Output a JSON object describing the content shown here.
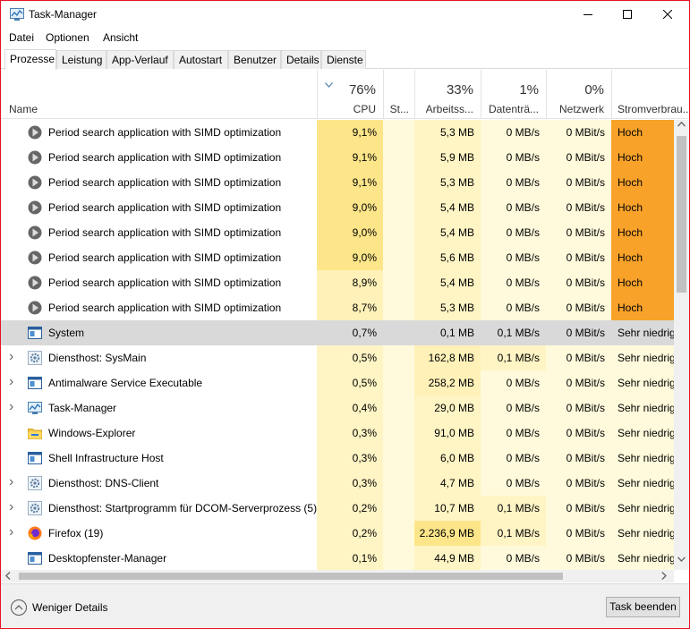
{
  "window": {
    "title": "Task-Manager"
  },
  "menu": [
    "Datei",
    "Optionen",
    "Ansicht"
  ],
  "tabs": [
    "Prozesse",
    "Leistung",
    "App-Verlauf",
    "Autostart",
    "Benutzer",
    "Details",
    "Dienste"
  ],
  "active_tab": "Prozesse",
  "columns": {
    "name": "Name",
    "cpu": {
      "pct": "76%",
      "label": "CPU"
    },
    "status": {
      "label": "St..."
    },
    "memory": {
      "pct": "33%",
      "label": "Arbeitss..."
    },
    "disk": {
      "pct": "1%",
      "label": "Datenträ..."
    },
    "network": {
      "pct": "0%",
      "label": "Netzwerk"
    },
    "power": {
      "label": "Stromverbrau..."
    }
  },
  "processes": [
    {
      "name": "Period search application with SIMD optimization",
      "icon": "play-app-icon",
      "expandable": false,
      "cpu": "9,1%",
      "memory": "5,3 MB",
      "disk": "0 MB/s",
      "network": "0 MBit/s",
      "power": "Hoch"
    },
    {
      "name": "Period search application with SIMD optimization",
      "icon": "play-app-icon",
      "expandable": false,
      "cpu": "9,1%",
      "memory": "5,9 MB",
      "disk": "0 MB/s",
      "network": "0 MBit/s",
      "power": "Hoch"
    },
    {
      "name": "Period search application with SIMD optimization",
      "icon": "play-app-icon",
      "expandable": false,
      "cpu": "9,1%",
      "memory": "5,3 MB",
      "disk": "0 MB/s",
      "network": "0 MBit/s",
      "power": "Hoch"
    },
    {
      "name": "Period search application with SIMD optimization",
      "icon": "play-app-icon",
      "expandable": false,
      "cpu": "9,0%",
      "memory": "5,4 MB",
      "disk": "0 MB/s",
      "network": "0 MBit/s",
      "power": "Hoch"
    },
    {
      "name": "Period search application with SIMD optimization",
      "icon": "play-app-icon",
      "expandable": false,
      "cpu": "9,0%",
      "memory": "5,4 MB",
      "disk": "0 MB/s",
      "network": "0 MBit/s",
      "power": "Hoch"
    },
    {
      "name": "Period search application with SIMD optimization",
      "icon": "play-app-icon",
      "expandable": false,
      "cpu": "9,0%",
      "memory": "5,6 MB",
      "disk": "0 MB/s",
      "network": "0 MBit/s",
      "power": "Hoch"
    },
    {
      "name": "Period search application with SIMD optimization",
      "icon": "play-app-icon",
      "expandable": false,
      "cpu": "8,9%",
      "memory": "5,4 MB",
      "disk": "0 MB/s",
      "network": "0 MBit/s",
      "power": "Hoch"
    },
    {
      "name": "Period search application with SIMD optimization",
      "icon": "play-app-icon",
      "expandable": false,
      "cpu": "8,7%",
      "memory": "5,3 MB",
      "disk": "0 MB/s",
      "network": "0 MBit/s",
      "power": "Hoch"
    },
    {
      "name": "System",
      "icon": "window-app-icon",
      "expandable": false,
      "selected": true,
      "cpu": "0,7%",
      "memory": "0,1 MB",
      "disk": "0,1 MB/s",
      "network": "0 MBit/s",
      "power": "Sehr niedrig"
    },
    {
      "name": "Diensthost: SysMain",
      "icon": "gear-icon",
      "expandable": true,
      "cpu": "0,5%",
      "memory": "162,8 MB",
      "disk": "0,1 MB/s",
      "network": "0 MBit/s",
      "power": "Sehr niedrig"
    },
    {
      "name": "Antimalware Service Executable",
      "icon": "window-app-icon",
      "expandable": true,
      "cpu": "0,5%",
      "memory": "258,2 MB",
      "disk": "0 MB/s",
      "network": "0 MBit/s",
      "power": "Sehr niedrig"
    },
    {
      "name": "Task-Manager",
      "icon": "task-manager-icon",
      "expandable": true,
      "cpu": "0,4%",
      "memory": "29,0 MB",
      "disk": "0 MB/s",
      "network": "0 MBit/s",
      "power": "Sehr niedrig"
    },
    {
      "name": "Windows-Explorer",
      "icon": "folder-icon",
      "expandable": false,
      "cpu": "0,3%",
      "memory": "91,0 MB",
      "disk": "0 MB/s",
      "network": "0 MBit/s",
      "power": "Sehr niedrig"
    },
    {
      "name": "Shell Infrastructure Host",
      "icon": "window-app-icon",
      "expandable": false,
      "cpu": "0,3%",
      "memory": "6,0 MB",
      "disk": "0 MB/s",
      "network": "0 MBit/s",
      "power": "Sehr niedrig"
    },
    {
      "name": "Diensthost: DNS-Client",
      "icon": "gear-icon",
      "expandable": true,
      "cpu": "0,3%",
      "memory": "4,7 MB",
      "disk": "0 MB/s",
      "network": "0 MBit/s",
      "power": "Sehr niedrig"
    },
    {
      "name": "Diensthost: Startprogramm für DCOM-Serverprozess (5)",
      "icon": "gear-icon",
      "expandable": true,
      "cpu": "0,2%",
      "memory": "10,7 MB",
      "disk": "0,1 MB/s",
      "network": "0 MBit/s",
      "power": "Sehr niedrig"
    },
    {
      "name": "Firefox (19)",
      "icon": "firefox-icon",
      "expandable": true,
      "cpu": "0,2%",
      "memory": "2.236,9 MB",
      "disk": "0,1 MB/s",
      "network": "0 MBit/s",
      "power": "Sehr niedrig"
    },
    {
      "name": "Desktopfenster-Manager",
      "icon": "window-app-icon",
      "expandable": false,
      "cpu": "0,1%",
      "memory": "44,9 MB",
      "disk": "0 MB/s",
      "network": "0 MBit/s",
      "power": "Sehr niedrig"
    }
  ],
  "colors": {
    "heat_high": "#fde68a",
    "heat_mid": "#fff1b8",
    "heat_low": "#fff4c4",
    "heat_verylow": "#fffadb",
    "power_high": "#f8a22a",
    "selected_row": "#d9d9d9"
  },
  "footer": {
    "less_details": "Weniger Details",
    "end_task": "Task beenden"
  }
}
